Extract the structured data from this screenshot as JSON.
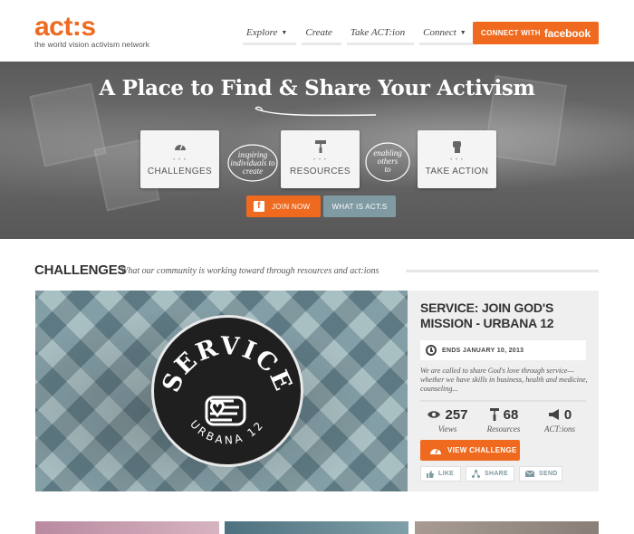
{
  "header": {
    "logo": "act:s",
    "tagline": "the world vision activism network",
    "nav": [
      {
        "label": "Explore",
        "has_caret": true
      },
      {
        "label": "Create",
        "has_caret": false
      },
      {
        "label": "Take ACT:ion",
        "has_caret": false
      },
      {
        "label": "Connect",
        "has_caret": true
      }
    ],
    "connect_button": {
      "prefix": "CONNECT WITH",
      "brand": "facebook"
    }
  },
  "hero": {
    "title": "A Place to Find & Share Your Activism",
    "cards": [
      {
        "label": "CHALLENGES",
        "icon": "gauge-icon"
      },
      {
        "label": "RESOURCES",
        "icon": "paint-roller-icon"
      },
      {
        "label": "TAKE ACTION",
        "icon": "raised-fist-icon"
      }
    ],
    "bubble_1": [
      "inspiring",
      "individuals to",
      "create"
    ],
    "bubble_2": [
      "enabling",
      "others",
      "to"
    ],
    "join_label": "JOIN NOW",
    "join_icon_letter": "f",
    "what_label": "WHAT IS ACT:S"
  },
  "challenges": {
    "title": "CHALLENGES",
    "subtitle": "What our community is working toward through resources and act:ions",
    "feature": {
      "badge_title": "SERVICE",
      "badge_sub": "URBANA 12",
      "title": "SERVICE: JOIN GOD'S MISSION - URBANA 12",
      "ends": "ENDS JANUARY 10, 2013",
      "description": "We are called to share God's love through service—whether we have skills in business, health and medicine, counseling...",
      "stats": [
        {
          "value": "257",
          "label": "Views",
          "icon": "eye-icon"
        },
        {
          "value": "68",
          "label": "Resources",
          "icon": "paint-roller-icon"
        },
        {
          "value": "0",
          "label": "ACT:ions",
          "icon": "megaphone-icon"
        }
      ],
      "view_button": "VIEW CHALLENGE",
      "actions": [
        {
          "label": "LIKE",
          "icon": "thumbs-up-icon"
        },
        {
          "label": "SHARE",
          "icon": "share-icon"
        },
        {
          "label": "SEND",
          "icon": "envelope-icon"
        }
      ]
    }
  },
  "colors": {
    "accent": "#ef6a1f",
    "slate": "#7f9aa2",
    "text": "#333333"
  }
}
